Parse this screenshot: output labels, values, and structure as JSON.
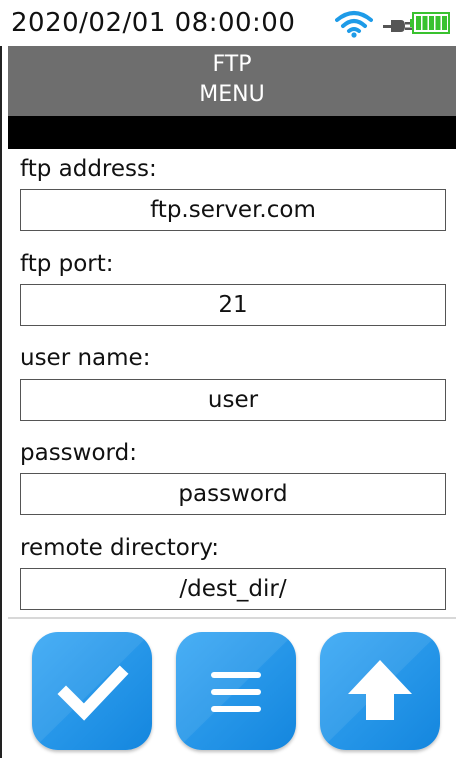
{
  "status_bar": {
    "datetime": "2020/02/01 08:00:00",
    "wifi_icon": "wifi-icon",
    "plug_icon": "plug-icon",
    "battery_icon": "battery-icon",
    "battery_level": 1.0
  },
  "header": {
    "title_line1": "FTP",
    "title_line2": "MENU"
  },
  "form": {
    "fields": [
      {
        "label": "ftp address:",
        "value": "ftp.server.com"
      },
      {
        "label": "ftp port:",
        "value": "21"
      },
      {
        "label": "user name:",
        "value": "user"
      },
      {
        "label": "password:",
        "value": "password"
      },
      {
        "label": "remote directory:",
        "value": "/dest_dir/"
      }
    ]
  },
  "actions": {
    "confirm_icon": "checkmark-icon",
    "menu_icon": "hamburger-menu-icon",
    "upload_icon": "upload-arrow-icon"
  },
  "colors": {
    "title_bar": "#6e6e6e",
    "button_blue": "#1a8fe6",
    "battery_green": "#39c22f"
  }
}
